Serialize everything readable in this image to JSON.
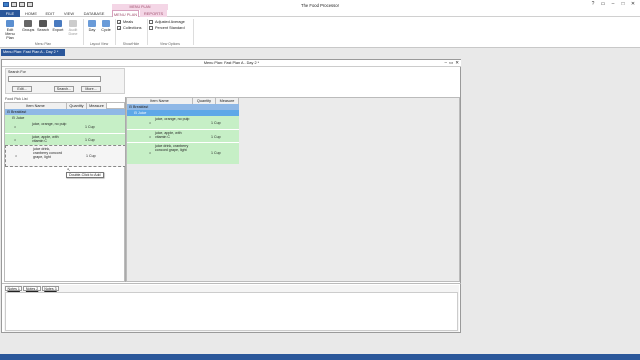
{
  "app": {
    "title": "The Food Processor",
    "contextual_group": "MENU PLAN"
  },
  "menu": {
    "tabs": [
      "FILE",
      "HOME",
      "EDIT",
      "VIEW",
      "DATABASE",
      "MENU PLAN",
      "REPORTS"
    ]
  },
  "ribbon": {
    "buttons": [
      "Edit\nMenu Plan",
      "Groups",
      "Search",
      "Export",
      "Audit\nDone",
      "Day",
      "Cycle"
    ],
    "checks": [
      {
        "label": "Meals",
        "checked": true
      },
      {
        "label": "Collections",
        "checked": true
      },
      {
        "label": "Adjusted Average",
        "checked": false
      },
      {
        "label": "Percent Standard",
        "checked": false
      }
    ],
    "groups": [
      "Menu Plan",
      "Layout View",
      "Show/Hide",
      "View Options"
    ]
  },
  "doc_tab": "Menu Plan: Fast Plan A - Day 2 *",
  "child": {
    "title": "Menu Plan: Fast Plan A - Day 2 *",
    "search_label": "Search For",
    "search_value": "",
    "btn_edit": "Edit...",
    "btn_search": "Search...",
    "btn_more": "More...",
    "food_pick_label": "Food Pick List",
    "headers": [
      "Item Name",
      "Quantity",
      "Measure"
    ],
    "left_rows": [
      {
        "kind": "cat",
        "name": "Breakfast",
        "qty": "",
        "measure": ""
      },
      {
        "kind": "sub",
        "name": "Juice",
        "qty": "",
        "measure": ""
      },
      {
        "kind": "item",
        "name": "juice, orange, no pulp",
        "qty": "1",
        "measure": "Cup"
      },
      {
        "kind": "item",
        "name": "juice, apple, with vitamin C",
        "qty": "1",
        "measure": "Cup"
      },
      {
        "kind": "item",
        "name": "juice drink, cranberry concord grape, light",
        "qty": "1",
        "measure": "Cup"
      }
    ],
    "tooltip": "Double-Click to Add",
    "right_rows": [
      {
        "kind": "cat",
        "name": "Breakfast",
        "qty": "",
        "measure": ""
      },
      {
        "kind": "sub",
        "name": "Juice",
        "qty": "",
        "measure": ""
      },
      {
        "kind": "item",
        "name": "juice, orange, no pulp",
        "qty": "1",
        "measure": "Cup"
      },
      {
        "kind": "item",
        "name": "juice, apple, with vitamin C",
        "qty": "1",
        "measure": "Cup"
      },
      {
        "kind": "item",
        "name": "juice drink, cranberry concord grape, light",
        "qty": "1",
        "measure": "Cup"
      }
    ],
    "notes_tabs": [
      "Notes 1",
      "Notes 2",
      "Notes 3"
    ]
  },
  "colors": {
    "ribbon_blue": "#2b579a",
    "contextual_pink": "#e6a6c8",
    "row_green": "#c6efc6",
    "row_blue": "#8fb8e6",
    "status_blue": "#2b579a"
  }
}
